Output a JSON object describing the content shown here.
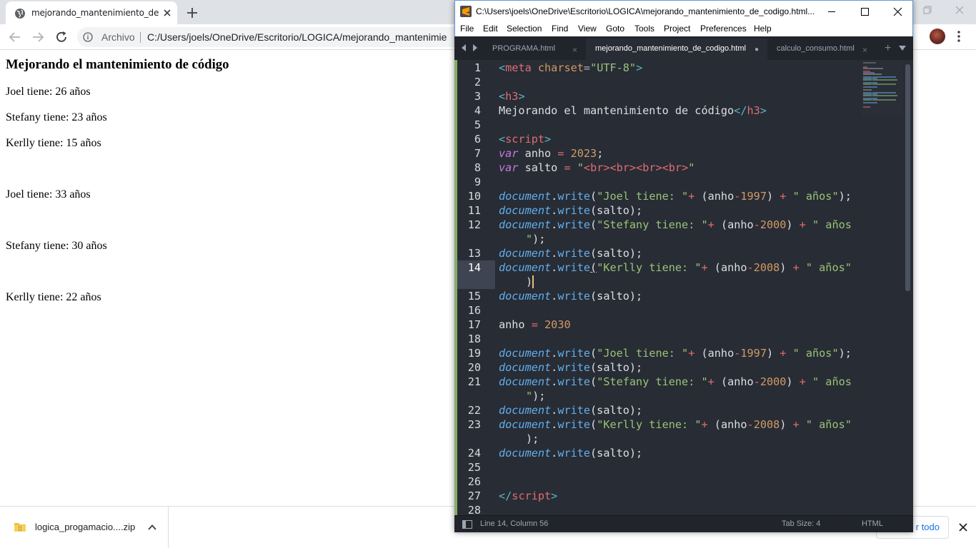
{
  "browser": {
    "tab_title": "mejorando_mantenimiento_de_c",
    "origin_label": "Archivo",
    "url": "C:/Users/joels/OneDrive/Escritorio/LOGICA/mejorando_mantenimie"
  },
  "page": {
    "heading": "Mejorando el mantenimiento de código",
    "lines": [
      "Joel tiene: 26 años",
      "Stefany tiene: 23 años",
      "Kerlly tiene: 15 años",
      "Joel tiene: 33 años",
      "Stefany tiene: 30 años",
      "Kerlly tiene: 22 años"
    ]
  },
  "downloads": {
    "file_name": "logica_progamacio....zip",
    "show_all_label": "r todo"
  },
  "sublime": {
    "title": "C:\\Users\\joels\\OneDrive\\Escritorio\\LOGICA\\mejorando_mantenimiento_de_codigo.html...",
    "menu": [
      "File",
      "Edit",
      "Selection",
      "Find",
      "View",
      "Goto",
      "Tools",
      "Project",
      "Preferences",
      "Help"
    ],
    "tabs": [
      {
        "label": "PROGRAMA.html",
        "close": "×"
      },
      {
        "label": "mejorando_mantenimiento_de_codigo.html",
        "close": "●"
      },
      {
        "label": "calculo_consumo.html",
        "close": "×"
      }
    ],
    "line_numbers": [
      "1",
      "2",
      "3",
      "4",
      "5",
      "6",
      "7",
      "8",
      "9",
      "10",
      "11",
      "12",
      "13",
      "14",
      "15",
      "16",
      "17",
      "18",
      "19",
      "20",
      "21",
      "22",
      "23",
      "24",
      "25",
      "26",
      "27",
      "28"
    ],
    "status": {
      "position": "Line 14, Column 56",
      "tab_size": "Tab Size: 4",
      "syntax": "HTML"
    }
  },
  "colors": {
    "editor_bg": "#282c34",
    "tag": "#e06c75",
    "string": "#98c379",
    "number": "#d19a66",
    "function": "#61afef",
    "keyword": "#c678dd"
  },
  "icons": [
    "globe-icon",
    "close-icon",
    "plus-icon",
    "back-arrow-icon",
    "forward-arrow-icon",
    "reload-icon",
    "info-icon",
    "kebab-menu-icon",
    "zip-file-icon",
    "chevron-up-icon",
    "sublime-logo-icon",
    "minimize-icon",
    "maximize-icon",
    "sidebar-toggle-icon"
  ]
}
